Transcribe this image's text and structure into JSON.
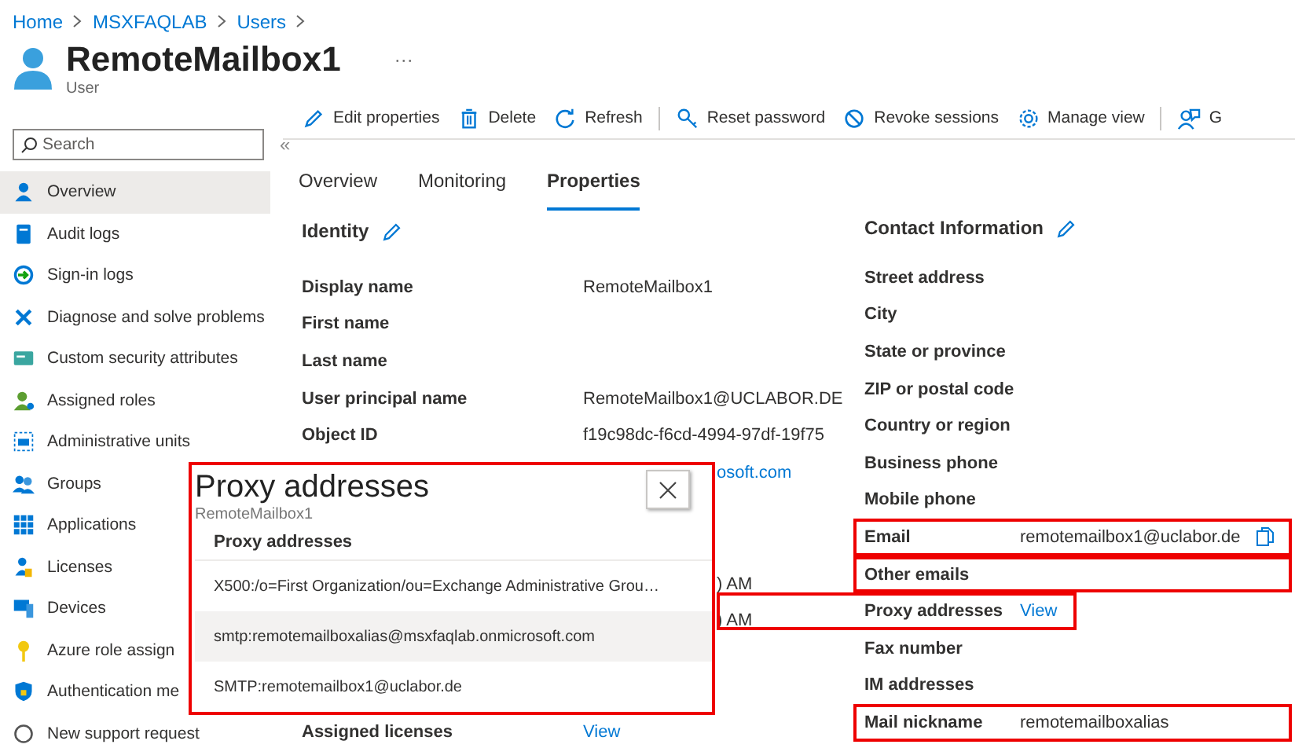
{
  "breadcrumb": [
    "Home",
    "MSXFAQLAB",
    "Users"
  ],
  "header": {
    "title": "RemoteMailbox1",
    "more": "···",
    "subtitle": "User"
  },
  "sidebar": {
    "search": {
      "placeholder": "Search"
    },
    "collapse": "«",
    "items": [
      {
        "label": "Overview",
        "selected": true
      },
      {
        "label": "Audit logs",
        "selected": false
      },
      {
        "label": "Sign-in logs",
        "selected": false
      },
      {
        "label": "Diagnose and solve problems",
        "selected": false
      },
      {
        "label": "Custom security attributes",
        "selected": false
      },
      {
        "label": "Assigned roles",
        "selected": false
      },
      {
        "label": "Administrative units",
        "selected": false
      },
      {
        "label": "Groups",
        "selected": false
      },
      {
        "label": "Applications",
        "selected": false
      },
      {
        "label": "Licenses",
        "selected": false
      },
      {
        "label": "Devices",
        "selected": false
      },
      {
        "label": "Azure role assign",
        "selected": false
      },
      {
        "label": "Authentication me",
        "selected": false
      },
      {
        "label": "New support request",
        "selected": false
      }
    ]
  },
  "toolbar": {
    "groups": [
      [
        "Edit properties",
        "Delete",
        "Refresh"
      ],
      [
        "Reset password",
        "Revoke sessions",
        "Manage view"
      ],
      [
        "G"
      ]
    ]
  },
  "tabs": [
    {
      "label": "Overview",
      "selected": false
    },
    {
      "label": "Monitoring",
      "selected": false
    },
    {
      "label": "Properties",
      "selected": true
    }
  ],
  "identity": {
    "title": "Identity",
    "rows": [
      {
        "kind": "field",
        "label": "Display name",
        "value": "RemoteMailbox1"
      },
      {
        "kind": "field",
        "label": "First name"
      },
      {
        "kind": "field",
        "label": "Last name"
      },
      {
        "kind": "field",
        "label": "User principal name",
        "value": "RemoteMailbox1@UCLABOR.DE"
      },
      {
        "kind": "field",
        "label": "Object ID",
        "value": "f19c98dc-f6cd-4994-97df-19f75"
      },
      {
        "kind": "peek-link",
        "value": "osoft.com"
      },
      {
        "kind": "hidden"
      },
      {
        "kind": "hidden"
      },
      {
        "kind": "peek",
        "value": ") AM"
      },
      {
        "kind": "peek",
        "value": ") AM"
      },
      {
        "kind": "hidden"
      },
      {
        "kind": "hidden"
      },
      {
        "kind": "field",
        "label": "Assigned licenses",
        "value": "View",
        "link": true
      }
    ]
  },
  "contact": {
    "title": "Contact Information",
    "rows": [
      {
        "label": "Street address",
        "highlighted": false
      },
      {
        "label": "City",
        "highlighted": false
      },
      {
        "label": "State or province",
        "highlighted": false
      },
      {
        "label": "ZIP or postal code",
        "highlighted": false
      },
      {
        "label": "Country or region",
        "highlighted": false
      },
      {
        "label": "Business phone",
        "highlighted": false
      },
      {
        "label": "Mobile phone",
        "highlighted": false
      },
      {
        "label": "Email",
        "value": "remotemailbox1@uclabor.de",
        "kind": "copy",
        "highlighted": true
      },
      {
        "label": "Other emails",
        "highlighted": true
      },
      {
        "label": "Proxy addresses",
        "value": "View",
        "kind": "link",
        "highlighted": true
      },
      {
        "label": "Fax number",
        "highlighted": false
      },
      {
        "label": "IM addresses",
        "highlighted": false
      },
      {
        "label": "Mail nickname",
        "value": "remotemailboxalias",
        "highlighted": true
      }
    ]
  },
  "dialog": {
    "title": "Proxy addresses",
    "subtitle": "RemoteMailbox1",
    "column": "Proxy addresses",
    "rows": [
      {
        "text": "X500:/o=First Organization/ou=Exchange Administrative Grou…",
        "selected": false
      },
      {
        "text": "smtp:remotemailboxalias@msxfaqlab.onmicrosoft.com",
        "selected": true
      },
      {
        "text": "SMTP:remotemailbox1@uclabor.de",
        "selected": false
      }
    ]
  }
}
